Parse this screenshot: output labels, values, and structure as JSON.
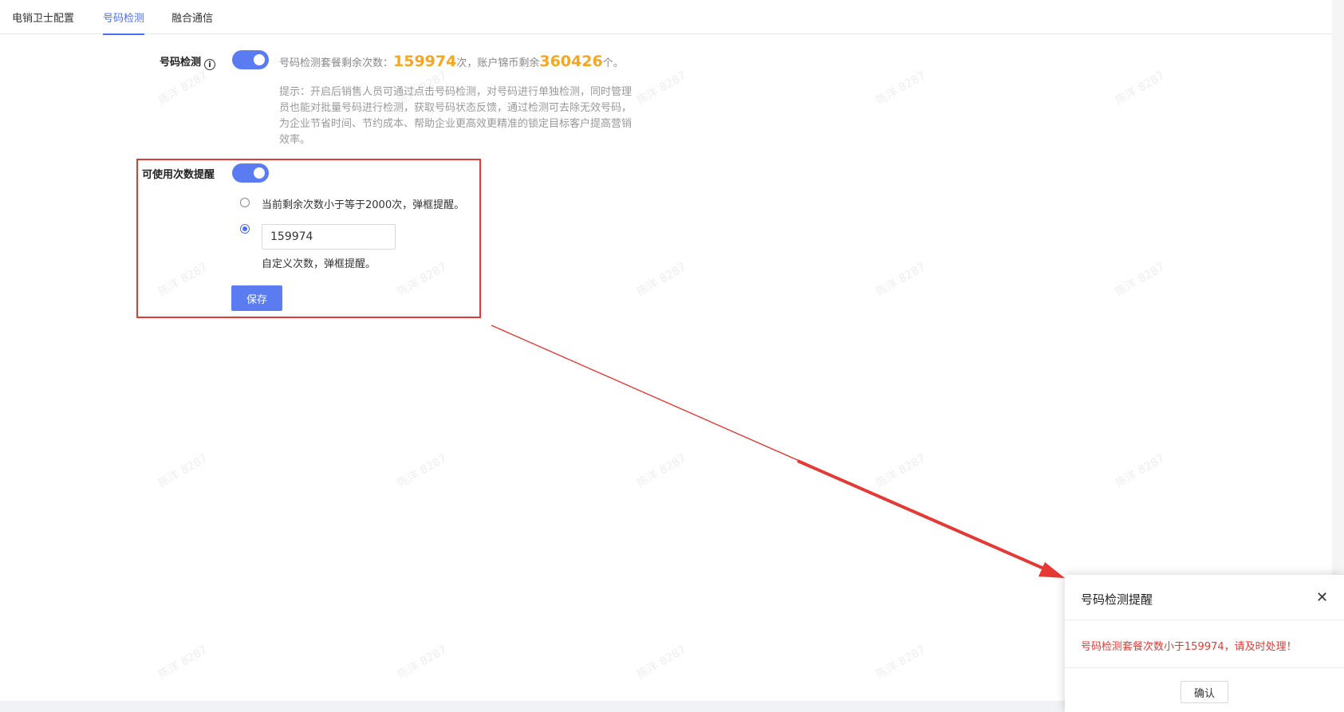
{
  "tabs": [
    {
      "label": "电销卫士配置",
      "active": false
    },
    {
      "label": "号码检测",
      "active": true
    },
    {
      "label": "融合通信",
      "active": false
    }
  ],
  "detection": {
    "label": "号码检测",
    "info_icon": "info-icon",
    "enabled": true,
    "quota_prefix": "号码检测套餐剩余次数：",
    "remaining_count": "159974",
    "quota_mid": "次，账户锦币剩余",
    "coin_balance": "360426",
    "quota_suffix": "个。",
    "hint": "提示：开启后销售人员可通过点击号码检测，对号码进行单独检测，同时管理员也能对批量号码进行检测，获取号码状态反馈，通过检测可去除无效号码，为企业节省时间、节约成本、帮助企业更高效更精准的锁定目标客户提高营销效率。"
  },
  "reminder": {
    "label": "可使用次数提醒",
    "enabled": true,
    "option_default": "当前剩余次数小于等于2000次，弹框提醒。",
    "option_custom_value": "159974",
    "option_custom_desc": "自定义次数，弹框提醒。",
    "selected": "custom",
    "save_label": "保存"
  },
  "watermark": "陈洋 8287",
  "dialog": {
    "title": "号码检测提醒",
    "close_icon": "close-icon",
    "message": "号码检测套餐次数小于159974，请及时处理！",
    "confirm_label": "确认"
  },
  "colors": {
    "accent": "#4c6ef5",
    "toggle": "#5b7cf0",
    "highlight_number": "#f5a623",
    "annotation_red": "#e53935"
  }
}
